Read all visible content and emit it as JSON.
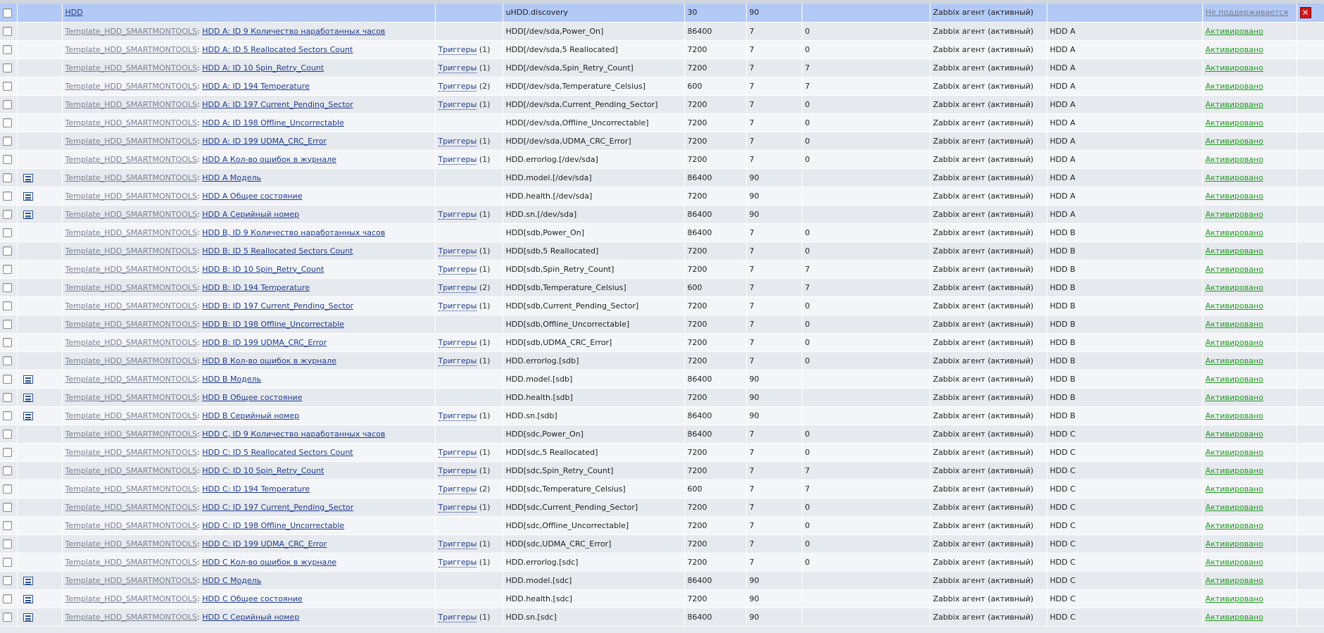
{
  "table": {
    "rows": [
      {
        "icon": false,
        "template": "",
        "name": "HDD",
        "triggers": "",
        "trig_count": "",
        "key": "uHDD.discovery",
        "interval": "30",
        "history": "90",
        "trends": "",
        "type": "Zabbix агент (активный)",
        "app": "",
        "status": "Не поддерживается",
        "status_kind": "bad",
        "error": true
      },
      {
        "icon": false,
        "template": "Template_HDD_SMARTMONTOOLS",
        "name": "HDD A: ID 9 Количество наработанных часов",
        "triggers": "",
        "trig_count": "",
        "key": "HDD[/dev/sda,Power_On]",
        "interval": "86400",
        "history": "7",
        "trends": "0",
        "type": "Zabbix агент (активный)",
        "app": "HDD A",
        "status": "Активировано",
        "status_kind": "ok",
        "error": false
      },
      {
        "icon": false,
        "template": "Template_HDD_SMARTMONTOOLS",
        "name": "HDD A: ID 5 Reallocated Sectors Count",
        "triggers": "Триггеры",
        "trig_count": "(1)",
        "key": "HDD[/dev/sda,5 Reallocated]",
        "interval": "7200",
        "history": "7",
        "trends": "0",
        "type": "Zabbix агент (активный)",
        "app": "HDD A",
        "status": "Активировано",
        "status_kind": "ok",
        "error": false
      },
      {
        "icon": false,
        "template": "Template_HDD_SMARTMONTOOLS",
        "name": "HDD A: ID 10 Spin_Retry_Count",
        "triggers": "Триггеры",
        "trig_count": "(1)",
        "key": "HDD[/dev/sda,Spin_Retry_Count]",
        "interval": "7200",
        "history": "7",
        "trends": "7",
        "type": "Zabbix агент (активный)",
        "app": "HDD A",
        "status": "Активировано",
        "status_kind": "ok",
        "error": false
      },
      {
        "icon": false,
        "template": "Template_HDD_SMARTMONTOOLS",
        "name": "HDD A: ID 194 Temperature",
        "triggers": "Триггеры",
        "trig_count": "(2)",
        "key": "HDD[/dev/sda,Temperature_Celsius]",
        "interval": "600",
        "history": "7",
        "trends": "7",
        "type": "Zabbix агент (активный)",
        "app": "HDD A",
        "status": "Активировано",
        "status_kind": "ok",
        "error": false
      },
      {
        "icon": false,
        "template": "Template_HDD_SMARTMONTOOLS",
        "name": "HDD A: ID 197 Current_Pending_Sector",
        "triggers": "Триггеры",
        "trig_count": "(1)",
        "key": "HDD[/dev/sda,Current_Pending_Sector]",
        "interval": "7200",
        "history": "7",
        "trends": "0",
        "type": "Zabbix агент (активный)",
        "app": "HDD A",
        "status": "Активировано",
        "status_kind": "ok",
        "error": false
      },
      {
        "icon": false,
        "template": "Template_HDD_SMARTMONTOOLS",
        "name": "HDD A: ID 198 Offline_Uncorrectable",
        "triggers": "",
        "trig_count": "",
        "key": "HDD[/dev/sda,Offline_Uncorrectable]",
        "interval": "7200",
        "history": "7",
        "trends": "0",
        "type": "Zabbix агент (активный)",
        "app": "HDD A",
        "status": "Активировано",
        "status_kind": "ok",
        "error": false
      },
      {
        "icon": false,
        "template": "Template_HDD_SMARTMONTOOLS",
        "name": "HDD A: ID 199 UDMA_CRC_Error",
        "triggers": "Триггеры",
        "trig_count": "(1)",
        "key": "HDD[/dev/sda,UDMA_CRC_Error]",
        "interval": "7200",
        "history": "7",
        "trends": "0",
        "type": "Zabbix агент (активный)",
        "app": "HDD A",
        "status": "Активировано",
        "status_kind": "ok",
        "error": false
      },
      {
        "icon": false,
        "template": "Template_HDD_SMARTMONTOOLS",
        "name": "HDD A Кол-во ошибок в журнале",
        "triggers": "Триггеры",
        "trig_count": "(1)",
        "key": "HDD.errorlog.[/dev/sda]",
        "interval": "7200",
        "history": "7",
        "trends": "0",
        "type": "Zabbix агент (активный)",
        "app": "HDD A",
        "status": "Активировано",
        "status_kind": "ok",
        "error": false
      },
      {
        "icon": true,
        "template": "Template_HDD_SMARTMONTOOLS",
        "name": "HDD A Модель",
        "triggers": "",
        "trig_count": "",
        "key": "HDD.model.[/dev/sda]",
        "interval": "86400",
        "history": "90",
        "trends": "",
        "type": "Zabbix агент (активный)",
        "app": "HDD A",
        "status": "Активировано",
        "status_kind": "ok",
        "error": false
      },
      {
        "icon": true,
        "template": "Template_HDD_SMARTMONTOOLS",
        "name": "HDD A Общее состояние",
        "triggers": "",
        "trig_count": "",
        "key": "HDD.health.[/dev/sda]",
        "interval": "7200",
        "history": "90",
        "trends": "",
        "type": "Zabbix агент (активный)",
        "app": "HDD A",
        "status": "Активировано",
        "status_kind": "ok",
        "error": false
      },
      {
        "icon": true,
        "template": "Template_HDD_SMARTMONTOOLS",
        "name": "HDD A Серийный номер",
        "triggers": "Триггеры",
        "trig_count": "(1)",
        "key": "HDD.sn.[/dev/sda]",
        "interval": "86400",
        "history": "90",
        "trends": "",
        "type": "Zabbix агент (активный)",
        "app": "HDD A",
        "status": "Активировано",
        "status_kind": "ok",
        "error": false
      },
      {
        "icon": false,
        "template": "Template_HDD_SMARTMONTOOLS",
        "name": "HDD B, ID 9 Количество наработанных часов",
        "triggers": "",
        "trig_count": "",
        "key": "HDD[sdb,Power_On]",
        "interval": "86400",
        "history": "7",
        "trends": "0",
        "type": "Zabbix агент (активный)",
        "app": "HDD B",
        "status": "Активировано",
        "status_kind": "ok",
        "error": false
      },
      {
        "icon": false,
        "template": "Template_HDD_SMARTMONTOOLS",
        "name": "HDD B: ID 5 Reallocated Sectors Count",
        "triggers": "Триггеры",
        "trig_count": "(1)",
        "key": "HDD[sdb,5 Reallocated]",
        "interval": "7200",
        "history": "7",
        "trends": "0",
        "type": "Zabbix агент (активный)",
        "app": "HDD B",
        "status": "Активировано",
        "status_kind": "ok",
        "error": false
      },
      {
        "icon": false,
        "template": "Template_HDD_SMARTMONTOOLS",
        "name": "HDD B: ID 10 Spin_Retry_Count",
        "triggers": "Триггеры",
        "trig_count": "(1)",
        "key": "HDD[sdb,Spin_Retry_Count]",
        "interval": "7200",
        "history": "7",
        "trends": "7",
        "type": "Zabbix агент (активный)",
        "app": "HDD B",
        "status": "Активировано",
        "status_kind": "ok",
        "error": false
      },
      {
        "icon": false,
        "template": "Template_HDD_SMARTMONTOOLS",
        "name": "HDD B: ID 194 Temperature",
        "triggers": "Триггеры",
        "trig_count": "(2)",
        "key": "HDD[sdb,Temperature_Celsius]",
        "interval": "600",
        "history": "7",
        "trends": "7",
        "type": "Zabbix агент (активный)",
        "app": "HDD B",
        "status": "Активировано",
        "status_kind": "ok",
        "error": false
      },
      {
        "icon": false,
        "template": "Template_HDD_SMARTMONTOOLS",
        "name": "HDD B: ID 197 Current_Pending_Sector",
        "triggers": "Триггеры",
        "trig_count": "(1)",
        "key": "HDD[sdb,Current_Pending_Sector]",
        "interval": "7200",
        "history": "7",
        "trends": "0",
        "type": "Zabbix агент (активный)",
        "app": "HDD B",
        "status": "Активировано",
        "status_kind": "ok",
        "error": false
      },
      {
        "icon": false,
        "template": "Template_HDD_SMARTMONTOOLS",
        "name": "HDD B: ID 198 Offline_Uncorrectable",
        "triggers": "",
        "trig_count": "",
        "key": "HDD[sdb,Offline_Uncorrectable]",
        "interval": "7200",
        "history": "7",
        "trends": "0",
        "type": "Zabbix агент (активный)",
        "app": "HDD B",
        "status": "Активировано",
        "status_kind": "ok",
        "error": false
      },
      {
        "icon": false,
        "template": "Template_HDD_SMARTMONTOOLS",
        "name": "HDD B: ID 199 UDMA_CRC_Error",
        "triggers": "Триггеры",
        "trig_count": "(1)",
        "key": "HDD[sdb,UDMA_CRC_Error]",
        "interval": "7200",
        "history": "7",
        "trends": "0",
        "type": "Zabbix агент (активный)",
        "app": "HDD B",
        "status": "Активировано",
        "status_kind": "ok",
        "error": false
      },
      {
        "icon": false,
        "template": "Template_HDD_SMARTMONTOOLS",
        "name": "HDD B Кол-во ошибок в журнале",
        "triggers": "Триггеры",
        "trig_count": "(1)",
        "key": "HDD.errorlog.[sdb]",
        "interval": "7200",
        "history": "7",
        "trends": "0",
        "type": "Zabbix агент (активный)",
        "app": "HDD B",
        "status": "Активировано",
        "status_kind": "ok",
        "error": false
      },
      {
        "icon": true,
        "template": "Template_HDD_SMARTMONTOOLS",
        "name": "HDD B Модель",
        "triggers": "",
        "trig_count": "",
        "key": "HDD.model.[sdb]",
        "interval": "86400",
        "history": "90",
        "trends": "",
        "type": "Zabbix агент (активный)",
        "app": "HDD B",
        "status": "Активировано",
        "status_kind": "ok",
        "error": false
      },
      {
        "icon": true,
        "template": "Template_HDD_SMARTMONTOOLS",
        "name": "HDD B Общее состояние",
        "triggers": "",
        "trig_count": "",
        "key": "HDD.health.[sdb]",
        "interval": "7200",
        "history": "90",
        "trends": "",
        "type": "Zabbix агент (активный)",
        "app": "HDD B",
        "status": "Активировано",
        "status_kind": "ok",
        "error": false
      },
      {
        "icon": true,
        "template": "Template_HDD_SMARTMONTOOLS",
        "name": "HDD B Серийный номер",
        "triggers": "Триггеры",
        "trig_count": "(1)",
        "key": "HDD.sn.[sdb]",
        "interval": "86400",
        "history": "90",
        "trends": "",
        "type": "Zabbix агент (активный)",
        "app": "HDD B",
        "status": "Активировано",
        "status_kind": "ok",
        "error": false
      },
      {
        "icon": false,
        "template": "Template_HDD_SMARTMONTOOLS",
        "name": "HDD C, ID 9 Количество наработанных часов",
        "triggers": "",
        "trig_count": "",
        "key": "HDD[sdc,Power_On]",
        "interval": "86400",
        "history": "7",
        "trends": "0",
        "type": "Zabbix агент (активный)",
        "app": "HDD C",
        "status": "Активировано",
        "status_kind": "ok",
        "error": false
      },
      {
        "icon": false,
        "template": "Template_HDD_SMARTMONTOOLS",
        "name": "HDD C: ID 5 Reallocated Sectors Count",
        "triggers": "Триггеры",
        "trig_count": "(1)",
        "key": "HDD[sdc,5 Reallocated]",
        "interval": "7200",
        "history": "7",
        "trends": "0",
        "type": "Zabbix агент (активный)",
        "app": "HDD C",
        "status": "Активировано",
        "status_kind": "ok",
        "error": false
      },
      {
        "icon": false,
        "template": "Template_HDD_SMARTMONTOOLS",
        "name": "HDD C: ID 10 Spin_Retry_Count",
        "triggers": "Триггеры",
        "trig_count": "(1)",
        "key": "HDD[sdc,Spin_Retry_Count]",
        "interval": "7200",
        "history": "7",
        "trends": "7",
        "type": "Zabbix агент (активный)",
        "app": "HDD C",
        "status": "Активировано",
        "status_kind": "ok",
        "error": false
      },
      {
        "icon": false,
        "template": "Template_HDD_SMARTMONTOOLS",
        "name": "HDD C: ID 194 Temperature",
        "triggers": "Триггеры",
        "trig_count": "(2)",
        "key": "HDD[sdc,Temperature_Celsius]",
        "interval": "600",
        "history": "7",
        "trends": "7",
        "type": "Zabbix агент (активный)",
        "app": "HDD C",
        "status": "Активировано",
        "status_kind": "ok",
        "error": false
      },
      {
        "icon": false,
        "template": "Template_HDD_SMARTMONTOOLS",
        "name": "HDD C: ID 197 Current_Pending_Sector",
        "triggers": "Триггеры",
        "trig_count": "(1)",
        "key": "HDD[sdc,Current_Pending_Sector]",
        "interval": "7200",
        "history": "7",
        "trends": "0",
        "type": "Zabbix агент (активный)",
        "app": "HDD C",
        "status": "Активировано",
        "status_kind": "ok",
        "error": false
      },
      {
        "icon": false,
        "template": "Template_HDD_SMARTMONTOOLS",
        "name": "HDD C: ID 198 Offline_Uncorrectable",
        "triggers": "",
        "trig_count": "",
        "key": "HDD[sdc,Offline_Uncorrectable]",
        "interval": "7200",
        "history": "7",
        "trends": "0",
        "type": "Zabbix агент (активный)",
        "app": "HDD C",
        "status": "Активировано",
        "status_kind": "ok",
        "error": false
      },
      {
        "icon": false,
        "template": "Template_HDD_SMARTMONTOOLS",
        "name": "HDD C: ID 199 UDMA_CRC_Error",
        "triggers": "Триггеры",
        "trig_count": "(1)",
        "key": "HDD[sdc,UDMA_CRC_Error]",
        "interval": "7200",
        "history": "7",
        "trends": "0",
        "type": "Zabbix агент (активный)",
        "app": "HDD C",
        "status": "Активировано",
        "status_kind": "ok",
        "error": false
      },
      {
        "icon": false,
        "template": "Template_HDD_SMARTMONTOOLS",
        "name": "HDD C Кол-во ошибок в журнале",
        "triggers": "Триггеры",
        "trig_count": "(1)",
        "key": "HDD.errorlog.[sdc]",
        "interval": "7200",
        "history": "7",
        "trends": "0",
        "type": "Zabbix агент (активный)",
        "app": "HDD C",
        "status": "Активировано",
        "status_kind": "ok",
        "error": false
      },
      {
        "icon": true,
        "template": "Template_HDD_SMARTMONTOOLS",
        "name": "HDD C Модель",
        "triggers": "",
        "trig_count": "",
        "key": "HDD.model.[sdc]",
        "interval": "86400",
        "history": "90",
        "trends": "",
        "type": "Zabbix агент (активный)",
        "app": "HDD C",
        "status": "Активировано",
        "status_kind": "ok",
        "error": false
      },
      {
        "icon": true,
        "template": "Template_HDD_SMARTMONTOOLS",
        "name": "HDD C Общее состояние",
        "triggers": "",
        "trig_count": "",
        "key": "HDD.health.[sdc]",
        "interval": "7200",
        "history": "90",
        "trends": "",
        "type": "Zabbix агент (активный)",
        "app": "HDD C",
        "status": "Активировано",
        "status_kind": "ok",
        "error": false
      },
      {
        "icon": true,
        "template": "Template_HDD_SMARTMONTOOLS",
        "name": "HDD C Серийный номер",
        "triggers": "Триггеры",
        "trig_count": "(1)",
        "key": "HDD.sn.[sdc]",
        "interval": "86400",
        "history": "90",
        "trends": "",
        "type": "Zabbix агент (активный)",
        "app": "HDD C",
        "status": "Активировано",
        "status_kind": "ok",
        "error": false
      }
    ]
  },
  "icons": {
    "host_item": "host-item-icon",
    "error": "error-x-icon",
    "error_glyph": "✕"
  },
  "colors": {
    "status_ok": "#1f9b1f",
    "status_bad": "#7b7b8f",
    "selected_row": "#b3c9f6",
    "error_icon": "#d11616"
  }
}
